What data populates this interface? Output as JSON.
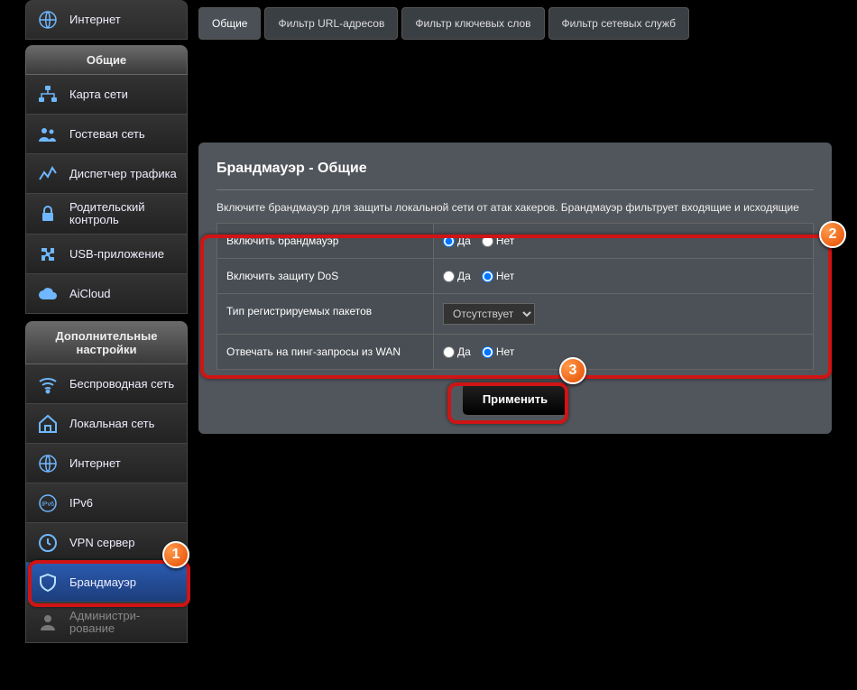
{
  "sidebar": {
    "top": {
      "label": "Интернет"
    },
    "general_header": "Общие",
    "general_items": [
      {
        "label": "Карта сети"
      },
      {
        "label": "Гостевая сеть"
      },
      {
        "label": "Диспетчер трафика"
      },
      {
        "label": "Родительский контроль"
      },
      {
        "label": "USB-приложение"
      },
      {
        "label": "AiCloud"
      }
    ],
    "advanced_header": "Дополнительные настройки",
    "advanced_items": [
      {
        "label": "Беспроводная сеть"
      },
      {
        "label": "Локальная сеть"
      },
      {
        "label": "Интернет"
      },
      {
        "label": "IPv6"
      },
      {
        "label": "VPN сервер"
      },
      {
        "label": "Брандмауэр"
      },
      {
        "label": "Администри-рование"
      }
    ]
  },
  "tabs": [
    {
      "label": "Общие",
      "active": true
    },
    {
      "label": "Фильтр URL-адресов",
      "active": false
    },
    {
      "label": "Фильтр ключевых слов",
      "active": false
    },
    {
      "label": "Фильтр сетевых служб",
      "active": false
    }
  ],
  "panel": {
    "title": "Брандмауэр - Общие",
    "description": "Включите брандмауэр для защиты локальной сети от атак хакеров. Брандмауэр фильтрует входящие и исходящие"
  },
  "options": {
    "yes": "Да",
    "no": "Нет"
  },
  "settings": [
    {
      "label": "Включить брандмауэр",
      "type": "radio",
      "value": "yes"
    },
    {
      "label": "Включить защиту DoS",
      "type": "radio",
      "value": "no"
    },
    {
      "label": "Тип регистрируемых пакетов",
      "type": "select",
      "selected": "Отсутствует"
    },
    {
      "label": "Отвечать на пинг-запросы из WAN",
      "type": "radio",
      "value": "no"
    }
  ],
  "apply_label": "Применить",
  "callouts": {
    "one": "1",
    "two": "2",
    "three": "3"
  }
}
